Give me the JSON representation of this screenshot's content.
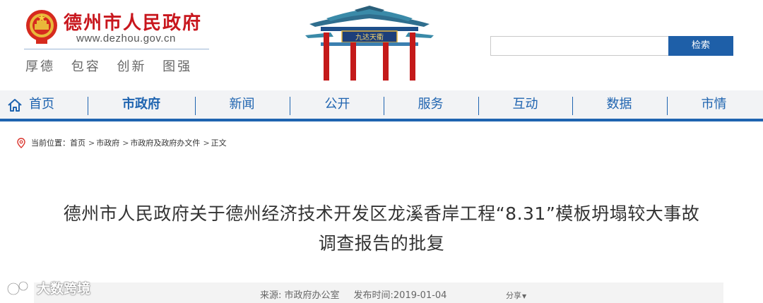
{
  "header": {
    "site_name": "德州市人民政府",
    "site_url": "www.dezhou.gov.cn",
    "motto": "厚德 包容 创新 图强",
    "gate_plaque": "九达天衢"
  },
  "search": {
    "button_label": "检索",
    "value": "",
    "placeholder": ""
  },
  "nav": {
    "items": [
      {
        "label": "首页",
        "icon": "home-icon"
      },
      {
        "label": "市政府",
        "active": true
      },
      {
        "label": "新闻"
      },
      {
        "label": "公开"
      },
      {
        "label": "服务"
      },
      {
        "label": "互动"
      },
      {
        "label": "数据"
      },
      {
        "label": "市情"
      }
    ]
  },
  "breadcrumb": {
    "prefix": "当前位置：",
    "items": [
      "首页",
      "市政府",
      "市政府及政府办文件",
      "正文"
    ],
    "separator": ">"
  },
  "article": {
    "title_line1": "德州市人民政府关于德州经济技术开发区龙溪香岸工程“8.31”模板坍塌较大事故",
    "title_line2": "调查报告的批复",
    "source": "来源: 市政府办公室",
    "published": "发布时间:2019-01-04",
    "share_label": "分享"
  },
  "watermark": {
    "text": "大数跨境"
  },
  "colors": {
    "brand_red": "#c8161d",
    "nav_blue": "#1f64b0",
    "search_button": "#1e5fa8",
    "nav_background": "#f2f3f5"
  }
}
